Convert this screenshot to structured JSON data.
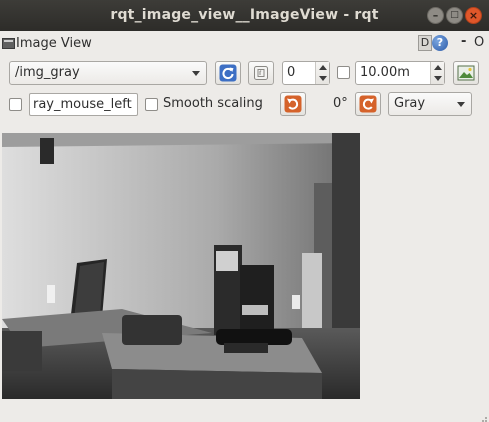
{
  "window": {
    "title": "rqt_image_view__ImageView - rqt",
    "controls": {
      "minimize": "–",
      "maximize": "□",
      "close": "×"
    }
  },
  "dock": {
    "title": "Image View",
    "d_label": "D",
    "help_label": "?",
    "minimize_label": "-",
    "close_label": "O"
  },
  "toolbar": {
    "topic": "/img_gray",
    "spin_value": "0",
    "max_range_value": "10.00m",
    "mouse_topic": "ray_mouse_left",
    "smooth_scaling_label": "Smooth scaling",
    "smooth_scaling_checked": false,
    "mouse_publish_checked": false,
    "range_checked": false,
    "rotation": "0°",
    "color_scheme": "Gray",
    "icons": [
      "refresh-icon",
      "zoom-reset-icon",
      "save-image-icon",
      "rotate-left-icon",
      "rotate-right-icon"
    ]
  },
  "image": {
    "description_icon": "camera-image",
    "colors": {
      "accent": "#3d6fc4",
      "rotate": "#d5622a"
    }
  }
}
